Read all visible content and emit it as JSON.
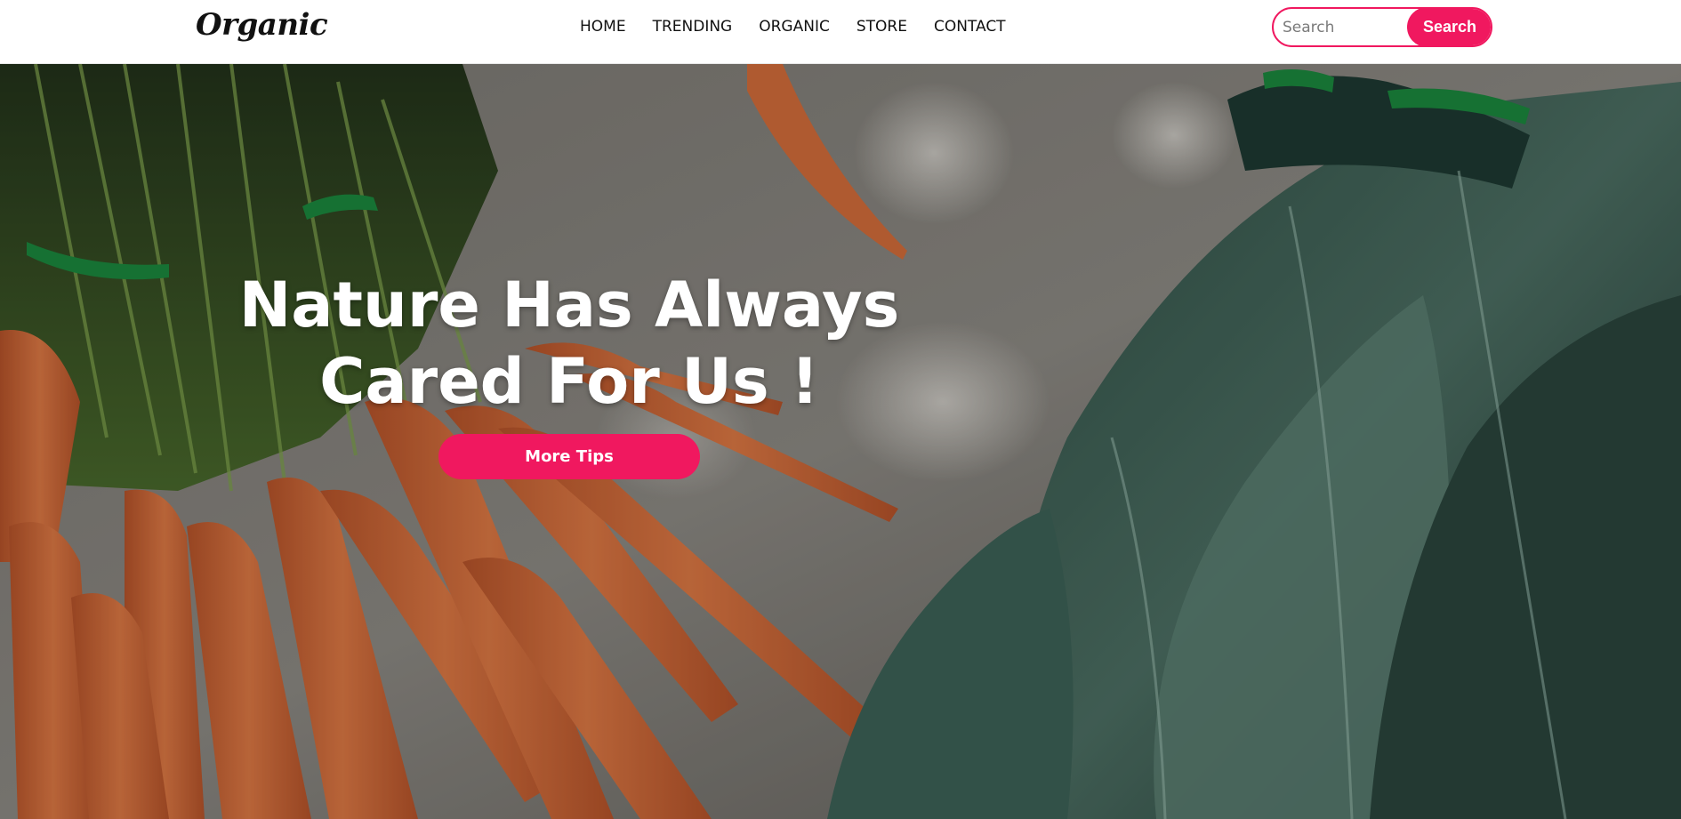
{
  "header": {
    "logo": "Organic",
    "nav": [
      {
        "label": "HOME"
      },
      {
        "label": "TRENDING"
      },
      {
        "label": "ORGANIC"
      },
      {
        "label": "STORE"
      },
      {
        "label": "CONTACT"
      }
    ],
    "search": {
      "placeholder": "Search",
      "value": "",
      "button_label": "Search"
    }
  },
  "hero": {
    "title_line1": "Nature Has Always",
    "title_line2": "Cared For Us !",
    "button_label": "More Tips",
    "background_image": "carrots-and-kale-photo"
  },
  "colors": {
    "accent": "#f0185f",
    "header_bg": "#ffffff",
    "hero_text": "#ffffff"
  }
}
